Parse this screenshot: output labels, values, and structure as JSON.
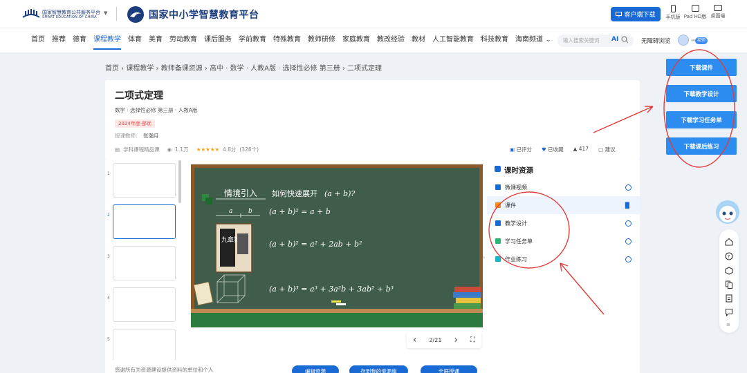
{
  "header": {
    "platform_cn": "国家智慧教育公共服务平台",
    "platform_en": "SMART EDUCATION OF CHINA",
    "brand": "国家中小学智慧教育平台",
    "client_download": "客户端下载",
    "devices": [
      "手机版",
      "Pad HD版",
      "桌面端"
    ]
  },
  "nav": {
    "items": [
      "首页",
      "推荐",
      "德育",
      "课程教学",
      "体育",
      "美育",
      "劳动教育",
      "课后服务",
      "学前教育",
      "特殊教育",
      "教师研修",
      "家庭教育",
      "教改经验",
      "教材",
      "人工智能教育",
      "科技教育",
      "海南频道"
    ],
    "active_index": 3,
    "search_placeholder": "输入搜索关键词",
    "search_ai": "AI",
    "accessibility": "无障碍浏览",
    "teacher_badge": "老师"
  },
  "breadcrumb": "首页 › 课程教学 › 教师备课资源 › 高中 · 数学 · 人教A版 · 选择性必修 第三册 › 二项式定理",
  "lesson": {
    "title": "二项式定理",
    "subtitle": "数学 · 选择性必修 第三册 · 人教A版",
    "badge": "2024年度·部优",
    "teacher_label": "授课教师:",
    "teacher_name": "张瀚月",
    "category": "学科课程精品课",
    "views": "1.1万",
    "rating": "4.8分",
    "rating_count": "(326个)",
    "actions": [
      "已评分",
      "已收藏",
      "417",
      "建议"
    ]
  },
  "thumbnails": {
    "numbers": [
      "1",
      "2",
      "3",
      "4",
      "5"
    ],
    "selected_index": 1
  },
  "slide": {
    "heading": "情境引入",
    "question": "如何快速展开",
    "question_expr": "(a + b)?",
    "seg_a": "a",
    "seg_b": "b",
    "book_title": "九章算术",
    "eq1": "(a + b)² = a + b",
    "eq2": "(a + b)² = a² + 2ab + b²",
    "eq3": "(a + b)³ = a³ + 3a²b + 3ab² + b³"
  },
  "slide_controls": {
    "page": "2/21"
  },
  "resources": {
    "title": "课时资源",
    "items": [
      {
        "label": "微课视频",
        "color": "#1a6ad6"
      },
      {
        "label": "课件",
        "color": "#f08a24"
      },
      {
        "label": "教学设计",
        "color": "#1a6ad6"
      },
      {
        "label": "学习任务单",
        "color": "#2bb673"
      },
      {
        "label": "作业练习",
        "color": "#1bb5c9"
      }
    ],
    "active_index": 1
  },
  "bottom": {
    "thanks": "感谢所有为资源建设提供资料的单位和个人",
    "buttons": [
      "编辑资源",
      "存到我的资源库",
      "全屏授课"
    ]
  },
  "downloads": [
    "下载课件",
    "下载教学设计",
    "下载学习任务单",
    "下载课后练习"
  ],
  "colors": {
    "primary": "#1a6ad6",
    "download_btn": "#2d8cf0",
    "annotation_red": "#e03c3c",
    "chalkboard": "#3f5d4a"
  }
}
